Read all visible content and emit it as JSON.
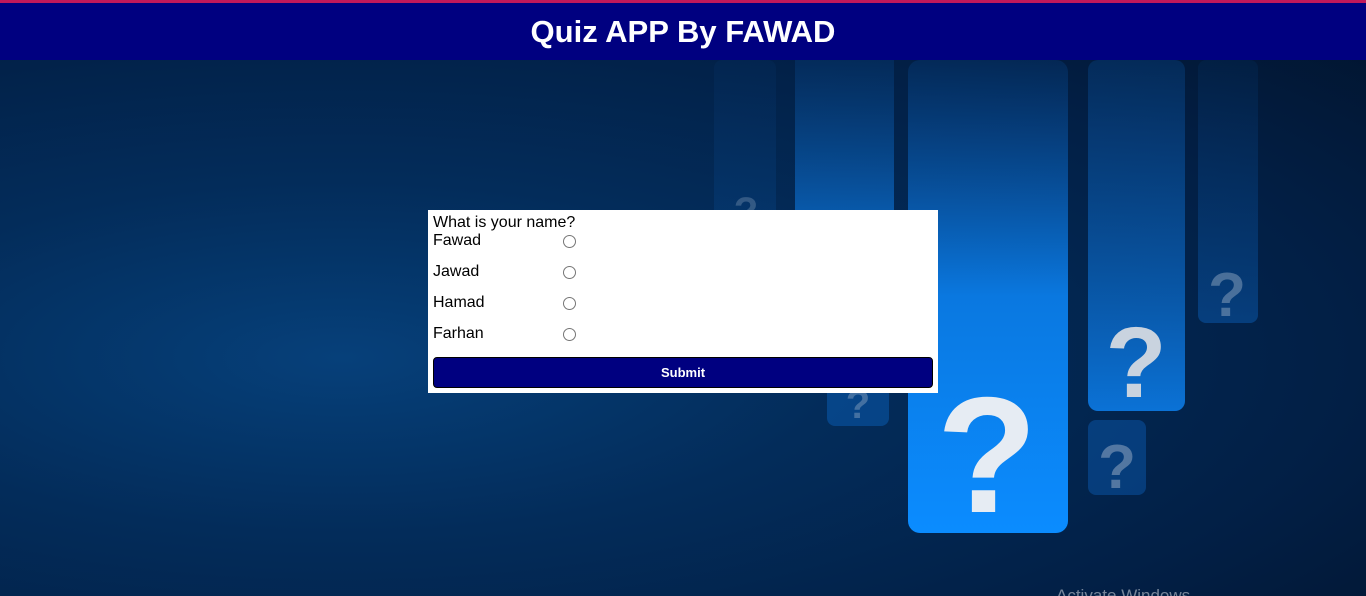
{
  "header": {
    "title": "Quiz APP By FAWAD"
  },
  "quiz": {
    "question": "What is your name?",
    "options": [
      {
        "label": "Fawad",
        "selected": false
      },
      {
        "label": "Jawad",
        "selected": false
      },
      {
        "label": "Hamad",
        "selected": false
      },
      {
        "label": "Farhan",
        "selected": false
      }
    ],
    "submit_label": "Submit"
  },
  "watermark": "Activate Windows",
  "colors": {
    "header_bg": "#000080",
    "accent_strip": "#c2185b",
    "button_bg": "#000080",
    "background": "#032c5a"
  }
}
